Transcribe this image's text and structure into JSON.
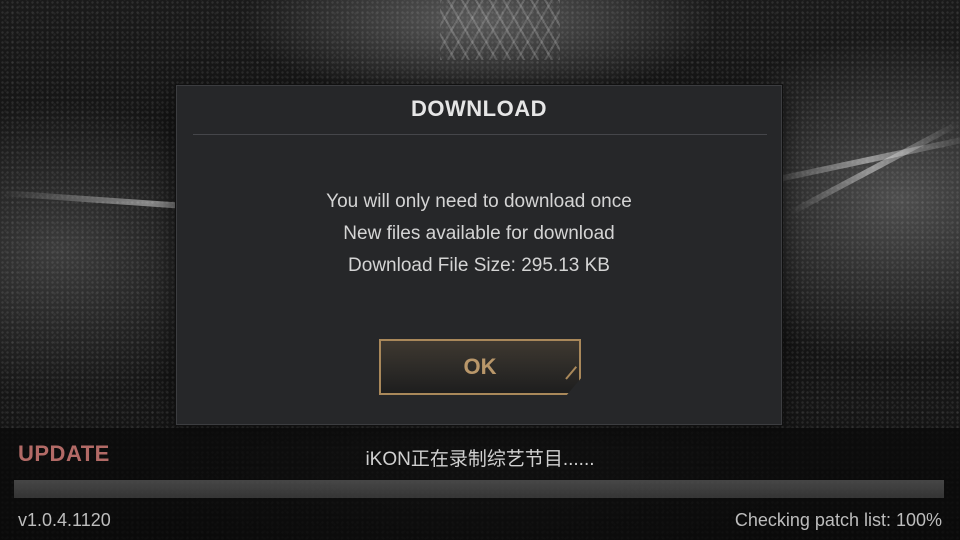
{
  "dialog": {
    "title": "DOWNLOAD",
    "lines": [
      "You will only need to download once",
      "New files available for download",
      "Download File Size: 295.13 KB"
    ],
    "ok_label": "OK"
  },
  "footer": {
    "update_label": "UPDATE",
    "status_message": "iKON正在录制综艺节目......",
    "version": "v1.0.4.1120",
    "patch_status": "Checking patch list: 100%",
    "progress_percent": 100
  },
  "colors": {
    "accent_gold": "#a9885a",
    "update_red": "#b26a66",
    "dialog_bg": "#262729"
  }
}
